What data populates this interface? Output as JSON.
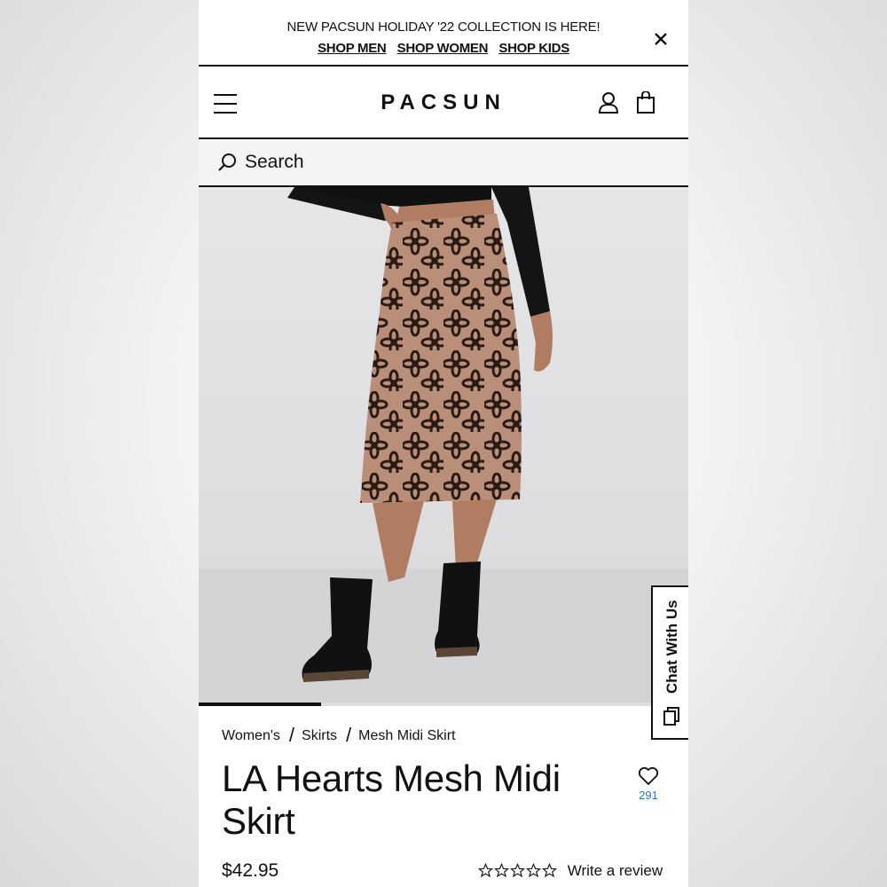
{
  "promo": {
    "text": "NEW PACSUN HOLIDAY '22 COLLECTION IS HERE!",
    "links": [
      "SHOP MEN",
      "SHOP WOMEN",
      "SHOP KIDS"
    ]
  },
  "header": {
    "logo": "PACSUN"
  },
  "search": {
    "placeholder": "Search"
  },
  "gallery": {
    "progress_fraction": 0.25
  },
  "chat": {
    "label": "Chat With Us"
  },
  "breadcrumb": [
    "Women's",
    "Skirts",
    "Mesh Midi Skirt"
  ],
  "product": {
    "title": "LA Hearts Mesh Midi Skirt",
    "favorites_count": "291",
    "price": "$42.95",
    "rating_stars": 0,
    "review_link": "Write a review"
  },
  "colors": {
    "accent_blue": "#2b7bd0",
    "skirt_base": "#b98f7a",
    "print": "#2a1a14"
  }
}
